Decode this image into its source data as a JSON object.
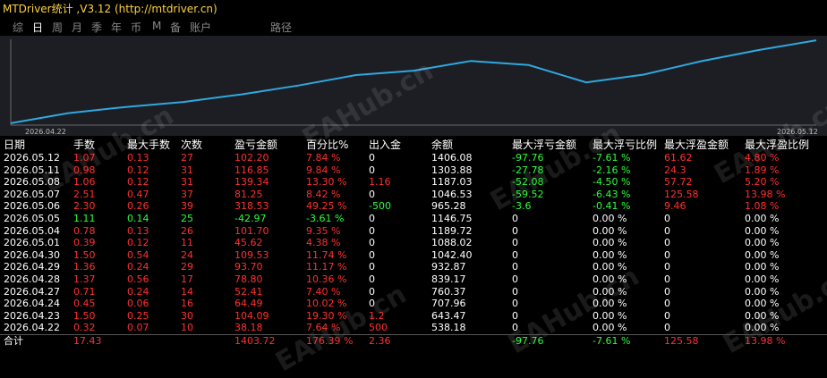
{
  "app": {
    "title": "MTDriver统计 ,V3.12 (http://mtdriver.cn)"
  },
  "tabs": [
    {
      "label": "综",
      "active": false
    },
    {
      "label": "日",
      "active": true
    },
    {
      "label": "周",
      "active": false
    },
    {
      "label": "月",
      "active": false
    },
    {
      "label": "季",
      "active": false
    },
    {
      "label": "年",
      "active": false
    },
    {
      "label": "币",
      "active": false
    },
    {
      "label": "M",
      "active": false
    },
    {
      "label": "备",
      "active": false
    },
    {
      "label": "账户",
      "active": false
    },
    {
      "label": "路径",
      "active": false
    }
  ],
  "watermark": "EAHub.cn",
  "chart_data": {
    "type": "line",
    "x": [
      "2026.04.22",
      "2026.04.23",
      "2026.04.24",
      "2026.04.27",
      "2026.04.28",
      "2026.04.29",
      "2026.04.30",
      "2026.05.01",
      "2026.05.04",
      "2026.05.05",
      "2026.05.06",
      "2026.05.07",
      "2026.05.08",
      "2026.05.11",
      "2026.05.12"
    ],
    "series": [
      {
        "values": [
          538.18,
          643.47,
          707.96,
          760.37,
          839.17,
          932.87,
          1042.4,
          1088.02,
          1189.72,
          1146.75,
          965.28,
          1046.53,
          1187.03,
          1303.88,
          1406.08
        ]
      }
    ],
    "x_start_label": "2026.04.22",
    "x_end_label": "2026.05.12",
    "line_color": "#2fa8e0"
  },
  "table": {
    "headers": [
      "日期",
      "手数",
      "最大手数",
      "次数",
      "盈亏金额",
      "百分比%",
      "出入金",
      "余额",
      "最大浮亏金额",
      "最大浮亏比例",
      "最大浮盈金额",
      "最大浮盈比例"
    ],
    "rows": [
      {
        "color": "red",
        "cells": [
          "2026.05.12",
          "1.07",
          "0.13",
          "27",
          "102.20",
          "7.84 %",
          "0",
          "1406.08",
          "-97.76",
          "-7.61 %",
          "61.62",
          "4.80 %"
        ]
      },
      {
        "color": "red",
        "cells": [
          "2026.05.11",
          "0.98",
          "0.12",
          "31",
          "116.85",
          "9.84 %",
          "0",
          "1303.88",
          "-27.78",
          "-2.16 %",
          "24.3",
          "1.89 %"
        ]
      },
      {
        "color": "red",
        "cells": [
          "2026.05.08",
          "1.06",
          "0.12",
          "31",
          "139.34",
          "13.30 %",
          "1.16",
          "1187.03",
          "-52.08",
          "-4.50 %",
          "57.72",
          "5.20 %"
        ]
      },
      {
        "color": "red",
        "cells": [
          "2026.05.07",
          "2.51",
          "0.47",
          "37",
          "81.25",
          "8.42 %",
          "0",
          "1046.53",
          "-59.52",
          "-6.43 %",
          "125.58",
          "13.98 %"
        ]
      },
      {
        "color": "red",
        "cells": [
          "2026.05.06",
          "2.30",
          "0.26",
          "39",
          "318.53",
          "49.25 %",
          "-500",
          "965.28",
          "-3.6",
          "-0.41 %",
          "9.46",
          "1.08 %"
        ]
      },
      {
        "color": "green",
        "cells": [
          "2026.05.05",
          "1.11",
          "0.14",
          "25",
          "-42.97",
          "-3.61 %",
          "0",
          "1146.75",
          "0",
          "0.00 %",
          "0",
          "0.00 %"
        ]
      },
      {
        "color": "red",
        "cells": [
          "2026.05.04",
          "0.78",
          "0.13",
          "26",
          "101.70",
          "9.35 %",
          "0",
          "1189.72",
          "0",
          "0.00 %",
          "0",
          "0.00 %"
        ]
      },
      {
        "color": "red",
        "cells": [
          "2026.05.01",
          "0.39",
          "0.12",
          "11",
          "45.62",
          "4.38 %",
          "0",
          "1088.02",
          "0",
          "0.00 %",
          "0",
          "0.00 %"
        ]
      },
      {
        "color": "red",
        "cells": [
          "2026.04.30",
          "1.50",
          "0.54",
          "24",
          "109.53",
          "11.74 %",
          "0",
          "1042.40",
          "0",
          "0.00 %",
          "0",
          "0.00 %"
        ]
      },
      {
        "color": "red",
        "cells": [
          "2026.04.29",
          "1.36",
          "0.24",
          "29",
          "93.70",
          "11.17 %",
          "0",
          "932.87",
          "0",
          "0.00 %",
          "0",
          "0.00 %"
        ]
      },
      {
        "color": "red",
        "cells": [
          "2026.04.28",
          "1.37",
          "0.56",
          "17",
          "78.80",
          "10.36 %",
          "0",
          "839.17",
          "0",
          "0.00 %",
          "0",
          "0.00 %"
        ]
      },
      {
        "color": "red",
        "cells": [
          "2026.04.27",
          "0.71",
          "0.24",
          "14",
          "52.41",
          "7.40 %",
          "0",
          "760.37",
          "0",
          "0.00 %",
          "0",
          "0.00 %"
        ]
      },
      {
        "color": "red",
        "cells": [
          "2026.04.24",
          "0.45",
          "0.06",
          "16",
          "64.49",
          "10.02 %",
          "0",
          "707.96",
          "0",
          "0.00 %",
          "0",
          "0.00 %"
        ]
      },
      {
        "color": "red",
        "cells": [
          "2026.04.23",
          "1.50",
          "0.25",
          "30",
          "104.09",
          "19.30 %",
          "1.2",
          "643.47",
          "0",
          "0.00 %",
          "0",
          "0.00 %"
        ]
      },
      {
        "color": "red",
        "cells": [
          "2026.04.22",
          "0.32",
          "0.07",
          "10",
          "38.18",
          "7.64 %",
          "500",
          "538.18",
          "0",
          "0.00 %",
          "0",
          "0.00 %"
        ]
      }
    ],
    "total": {
      "label": "合计",
      "cells": [
        {
          "text": "17.43",
          "color": "red"
        },
        {
          "text": "",
          "color": "red"
        },
        {
          "text": "",
          "color": "red"
        },
        {
          "text": "1403.72",
          "color": "red"
        },
        {
          "text": "176.39 %",
          "color": "red"
        },
        {
          "text": "2.36",
          "color": "red"
        },
        {
          "text": "",
          "color": "white"
        },
        {
          "text": "-97.76",
          "color": "green"
        },
        {
          "text": "-7.61 %",
          "color": "green"
        },
        {
          "text": "125.58",
          "color": "red"
        },
        {
          "text": "13.98 %",
          "color": "red"
        }
      ]
    }
  }
}
